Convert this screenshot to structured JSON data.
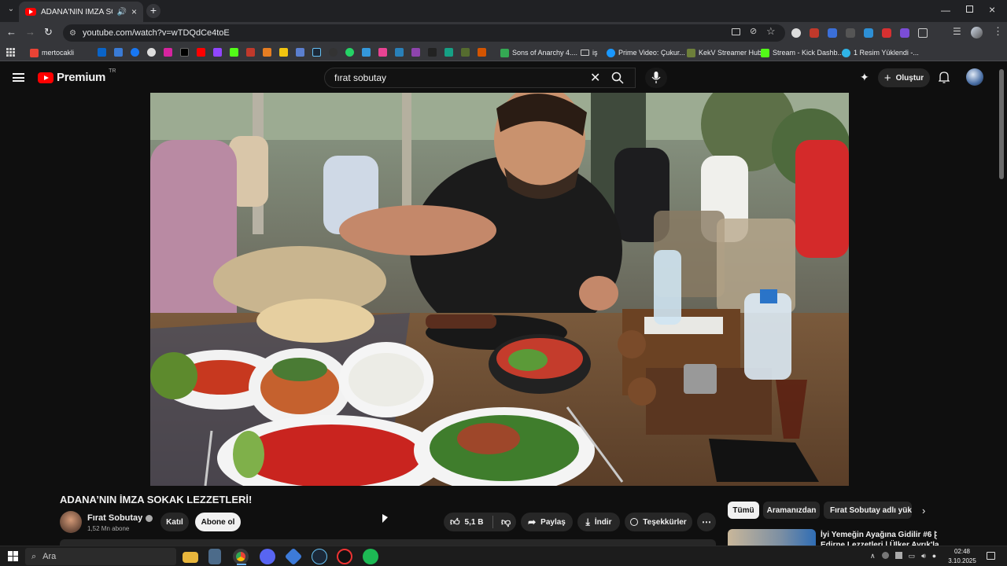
{
  "browser": {
    "tab": {
      "title": "ADANA'NIN İMZA SOKAK LEZZETLERİ",
      "title_display": "ADANA'NIN İMZA SOKAK |"
    },
    "url": "youtube.com/watch?v=wTDQdCe4toE",
    "bookmarks": [
      {
        "label": "mertocakli",
        "color": "#ea4335"
      },
      {
        "label": "Sons of Anarchy 4....",
        "color": "#34a853"
      },
      {
        "label": "iş",
        "color": "#9aa0a6"
      },
      {
        "label": "Prime Video: Çukur...",
        "color": "#1a98ff"
      },
      {
        "label": "KekV Streamer Hub",
        "color": "#6d7f3a"
      },
      {
        "label": "Stream - Kick Dashb...",
        "color": "#53fc18"
      },
      {
        "label": "1 Resim Yüklendi -...",
        "color": "#2fb5e8"
      }
    ]
  },
  "youtube": {
    "logo": "Premium",
    "country": "TR",
    "search_query": "fırat sobutay",
    "create_label": "Oluştur",
    "video": {
      "title": "ADANA’NIN İMZA SOKAK LEZZETLERİ!",
      "channel": "Fırat Sobutay",
      "subscribers": "1,52 Mn abone",
      "join_label": "Katıl",
      "subscribe_label": "Abone ol",
      "likes": "5,1 B",
      "share_label": "Paylaş",
      "download_label": "İndir",
      "thanks_label": "Teşekkürler"
    },
    "filter_chips": [
      "Tümü",
      "Aramanızdan",
      "Fırat Sobutay adlı yükle"
    ],
    "recommended": [
      {
        "title": "İyi Yemeğin Ayağına Gidilir #6 |",
        "title2": "Edirne Lezzetleri | Ülker Ayrık'la"
      }
    ]
  },
  "taskbar": {
    "search_placeholder": "Ara",
    "time": "02:48",
    "date": "3.10.2025"
  }
}
